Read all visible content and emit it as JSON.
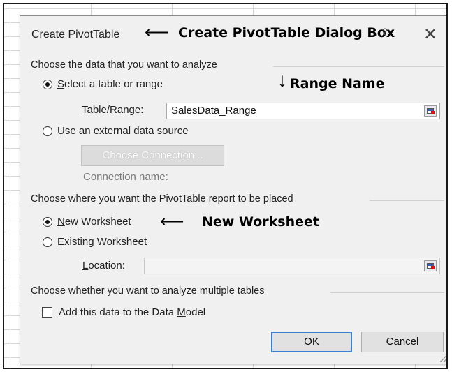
{
  "dialog": {
    "title": "Create PivotTable",
    "help_label": "?",
    "close_label": "✕"
  },
  "annotations": {
    "dialog_box": "Create PivotTable Dialog Box",
    "range_name": "Range Name",
    "new_worksheet": "New Worksheet"
  },
  "section_data": {
    "heading": "Choose the data that you want to analyze",
    "option_table": {
      "prefix": "",
      "accel": "S",
      "rest": "elect a table or range",
      "selected": true
    },
    "table_range_label": {
      "accel": "T",
      "rest": "able/Range:"
    },
    "table_range_value": "SalesData_Range",
    "option_external": {
      "accel": "U",
      "rest": "se an external data source",
      "selected": false
    },
    "choose_connection_label": "Choose Connection...",
    "connection_name_label": "Connection name:"
  },
  "section_place": {
    "heading": "Choose where you want the PivotTable report to be placed",
    "option_new": {
      "accel": "N",
      "rest": "ew Worksheet",
      "selected": true
    },
    "option_existing": {
      "accel": "E",
      "rest": "xisting Worksheet",
      "selected": false
    },
    "location_label": {
      "accel": "L",
      "rest": "ocation:"
    },
    "location_value": ""
  },
  "section_multi": {
    "heading": "Choose whether you want to analyze multiple tables",
    "checkbox_label_pre": "Add this data to the Data ",
    "checkbox_accel": "M",
    "checkbox_label_post": "odel",
    "checked": false
  },
  "buttons": {
    "ok": "OK",
    "cancel": "Cancel"
  },
  "icons": {
    "collapse": "range-collapse-icon",
    "arrow_left": "arrow-left-icon",
    "arrow_down": "arrow-down-icon",
    "grip": "resize-grip-icon"
  }
}
